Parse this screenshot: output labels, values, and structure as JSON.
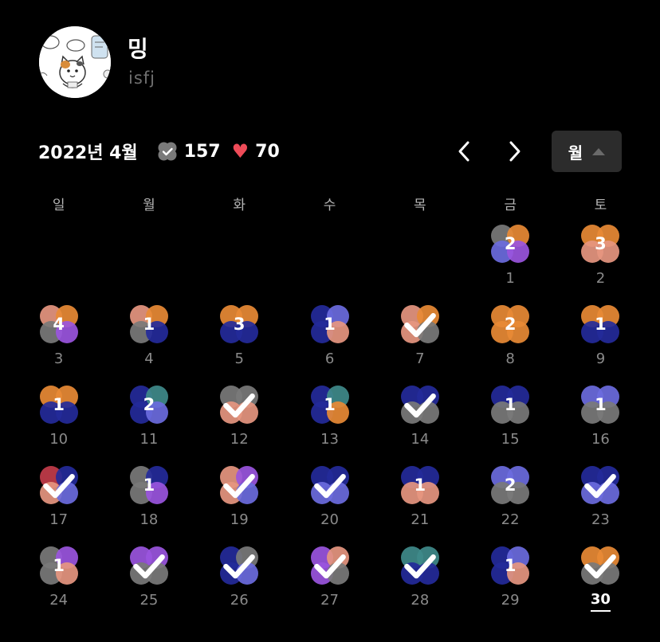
{
  "profile": {
    "name": "밍",
    "type": "isfj",
    "avatar_icon": "cartoon-cat-avatar-icon"
  },
  "header": {
    "month_label": "2022년 4월",
    "check_icon": "check-badge-icon",
    "check_count": "157",
    "heart_icon": "heart-icon",
    "heart_count": "70",
    "prev_icon": "chevron-left-icon",
    "next_icon": "chevron-right-icon",
    "view_label": "월",
    "view_icon": "caret-up-icon"
  },
  "weekdays": [
    "일",
    "월",
    "화",
    "수",
    "목",
    "금",
    "토"
  ],
  "colors": {
    "gray": "#7a7a7a",
    "orange": "#e88a35",
    "peach": "#e69680",
    "purple": "#9a55de",
    "periwinkle": "#6b6bde",
    "navy": "#242a9a",
    "teal": "#3f8a8a",
    "red": "#c23c4a",
    "heart": "#ee4b58"
  },
  "calendar": {
    "leading_blanks": 5,
    "today": "30",
    "days": [
      {
        "day": "1",
        "mark": "2",
        "colors": [
          "gray",
          "orange",
          "periwinkle",
          "purple"
        ]
      },
      {
        "day": "2",
        "mark": "3",
        "colors": [
          "orange",
          "orange",
          "peach",
          "peach"
        ]
      },
      {
        "day": "3",
        "mark": "4",
        "colors": [
          "peach",
          "orange",
          "gray",
          "purple"
        ]
      },
      {
        "day": "4",
        "mark": "1",
        "colors": [
          "peach",
          "orange",
          "gray",
          "navy"
        ]
      },
      {
        "day": "5",
        "mark": "3",
        "colors": [
          "orange",
          "orange",
          "navy",
          "navy"
        ]
      },
      {
        "day": "6",
        "mark": "1",
        "colors": [
          "navy",
          "periwinkle",
          "navy",
          "peach"
        ]
      },
      {
        "day": "7",
        "mark": "check",
        "colors": [
          "peach",
          "orange",
          "peach",
          "gray"
        ]
      },
      {
        "day": "8",
        "mark": "2",
        "colors": [
          "orange",
          "orange",
          "orange",
          "orange"
        ]
      },
      {
        "day": "9",
        "mark": "1",
        "colors": [
          "orange",
          "orange",
          "navy",
          "navy"
        ]
      },
      {
        "day": "10",
        "mark": "1",
        "colors": [
          "orange",
          "orange",
          "navy",
          "navy"
        ]
      },
      {
        "day": "11",
        "mark": "2",
        "colors": [
          "navy",
          "teal",
          "navy",
          "periwinkle"
        ]
      },
      {
        "day": "12",
        "mark": "check",
        "colors": [
          "gray",
          "gray",
          "peach",
          "peach"
        ]
      },
      {
        "day": "13",
        "mark": "1",
        "colors": [
          "navy",
          "teal",
          "navy",
          "orange"
        ]
      },
      {
        "day": "14",
        "mark": "check",
        "colors": [
          "navy",
          "navy",
          "gray",
          "gray"
        ]
      },
      {
        "day": "15",
        "mark": "1",
        "colors": [
          "navy",
          "navy",
          "gray",
          "gray"
        ]
      },
      {
        "day": "16",
        "mark": "1",
        "colors": [
          "periwinkle",
          "periwinkle",
          "gray",
          "gray"
        ]
      },
      {
        "day": "17",
        "mark": "check",
        "colors": [
          "red",
          "navy",
          "peach",
          "periwinkle"
        ]
      },
      {
        "day": "18",
        "mark": "1",
        "colors": [
          "gray",
          "navy",
          "gray",
          "purple"
        ]
      },
      {
        "day": "19",
        "mark": "check",
        "colors": [
          "peach",
          "purple",
          "peach",
          "periwinkle"
        ]
      },
      {
        "day": "20",
        "mark": "check",
        "colors": [
          "navy",
          "navy",
          "periwinkle",
          "periwinkle"
        ]
      },
      {
        "day": "21",
        "mark": "1",
        "colors": [
          "navy",
          "navy",
          "peach",
          "peach"
        ]
      },
      {
        "day": "22",
        "mark": "2",
        "colors": [
          "periwinkle",
          "periwinkle",
          "gray",
          "gray"
        ]
      },
      {
        "day": "23",
        "mark": "check",
        "colors": [
          "navy",
          "navy",
          "periwinkle",
          "periwinkle"
        ]
      },
      {
        "day": "24",
        "mark": "1",
        "colors": [
          "gray",
          "purple",
          "gray",
          "peach"
        ]
      },
      {
        "day": "25",
        "mark": "check",
        "colors": [
          "purple",
          "purple",
          "gray",
          "gray"
        ]
      },
      {
        "day": "26",
        "mark": "check",
        "colors": [
          "navy",
          "gray",
          "navy",
          "periwinkle"
        ]
      },
      {
        "day": "27",
        "mark": "check",
        "colors": [
          "purple",
          "peach",
          "purple",
          "gray"
        ]
      },
      {
        "day": "28",
        "mark": "check",
        "colors": [
          "teal",
          "teal",
          "navy",
          "navy"
        ]
      },
      {
        "day": "29",
        "mark": "1",
        "colors": [
          "navy",
          "periwinkle",
          "navy",
          "peach"
        ]
      },
      {
        "day": "30",
        "mark": "check",
        "colors": [
          "orange",
          "orange",
          "gray",
          "gray"
        ]
      }
    ]
  }
}
